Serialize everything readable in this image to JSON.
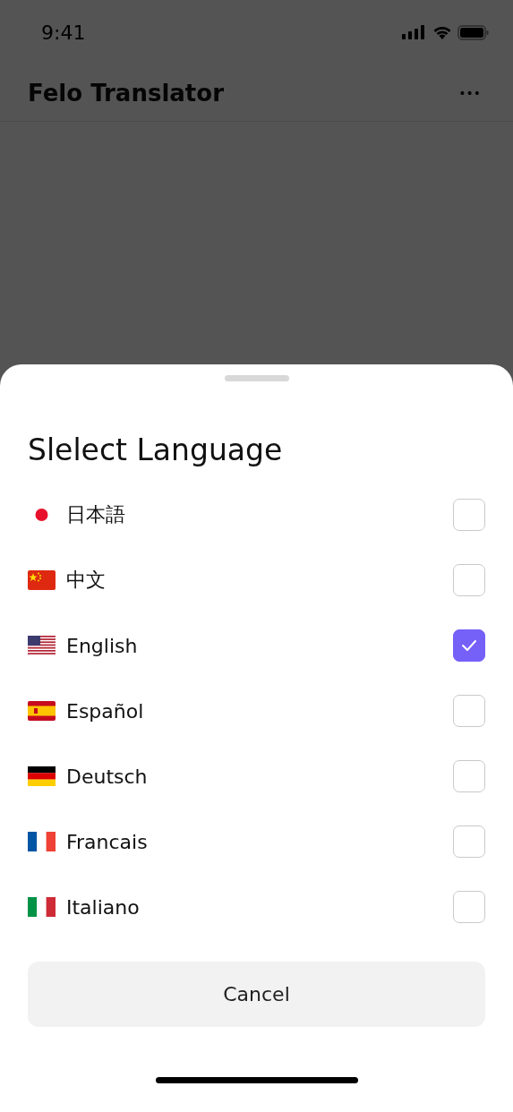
{
  "status_bar": {
    "time": "9:41"
  },
  "header": {
    "title": "Felo Translator",
    "menu": "•••"
  },
  "sheet": {
    "title": "Slelect Language",
    "languages": [
      {
        "label": "日本語",
        "selected": false
      },
      {
        "label": "中文",
        "selected": false
      },
      {
        "label": "English",
        "selected": true
      },
      {
        "label": "Español",
        "selected": false
      },
      {
        "label": "Deutsch",
        "selected": false
      },
      {
        "label": "Francais",
        "selected": false
      },
      {
        "label": "Italiano",
        "selected": false
      }
    ],
    "cancel": "Cancel"
  }
}
